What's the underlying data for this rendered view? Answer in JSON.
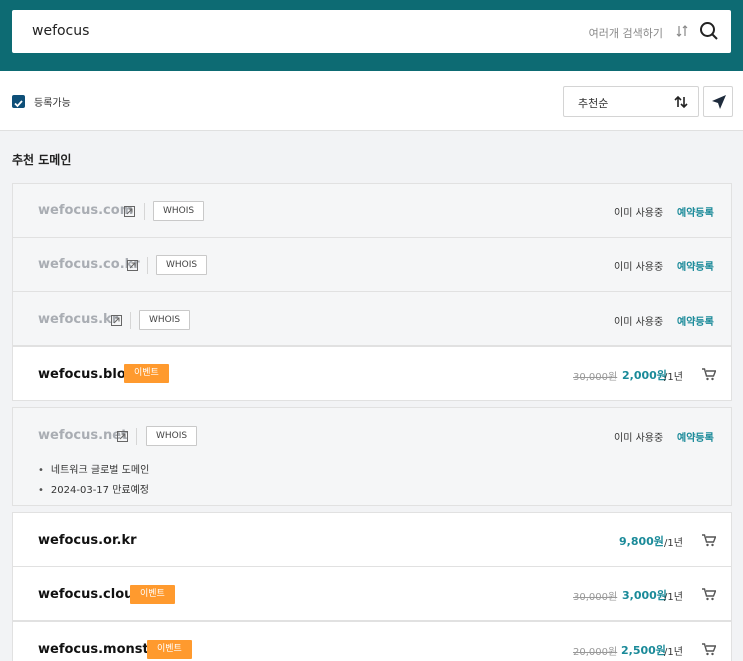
{
  "search": {
    "value": "wefocus",
    "multi_search_label": "여러개 검색하기"
  },
  "filter": {
    "checkbox_label": "등록가능",
    "checked": true,
    "sort_label": "추천순"
  },
  "section_title": "추천 도메인",
  "colors": {
    "brand": "#0d6b73",
    "accent": "#1a8a99",
    "event_badge": "#ff9a2e"
  },
  "domains": [
    {
      "name": "wefocus.com",
      "whois": "WHOIS",
      "status": "이미 사용중",
      "reserve": "예약등록"
    },
    {
      "name": "wefocus.co.kr",
      "whois": "WHOIS",
      "status": "이미 사용중",
      "reserve": "예약등록"
    },
    {
      "name": "wefocus.kr",
      "whois": "WHOIS",
      "status": "이미 사용중",
      "reserve": "예약등록"
    },
    {
      "name": "wefocus.blog",
      "badge": "이벤트",
      "old_price": "30,000원",
      "price": "2,000원",
      "period": "/1년"
    },
    {
      "name": "wefocus.net",
      "whois": "WHOIS",
      "status": "이미 사용중",
      "reserve": "예약등록",
      "notes": [
        "네트워크 글로벌 도메인",
        "2024-03-17 만료예정"
      ]
    },
    {
      "name": "wefocus.or.kr",
      "price": "9,800원",
      "period": "/1년"
    },
    {
      "name": "wefocus.cloud",
      "badge": "이벤트",
      "old_price": "30,000원",
      "price": "3,000원",
      "period": "/1년"
    },
    {
      "name": "wefocus.monster",
      "badge": "이벤트",
      "old_price": "20,000원",
      "price": "2,500원",
      "period": "/1년"
    }
  ]
}
